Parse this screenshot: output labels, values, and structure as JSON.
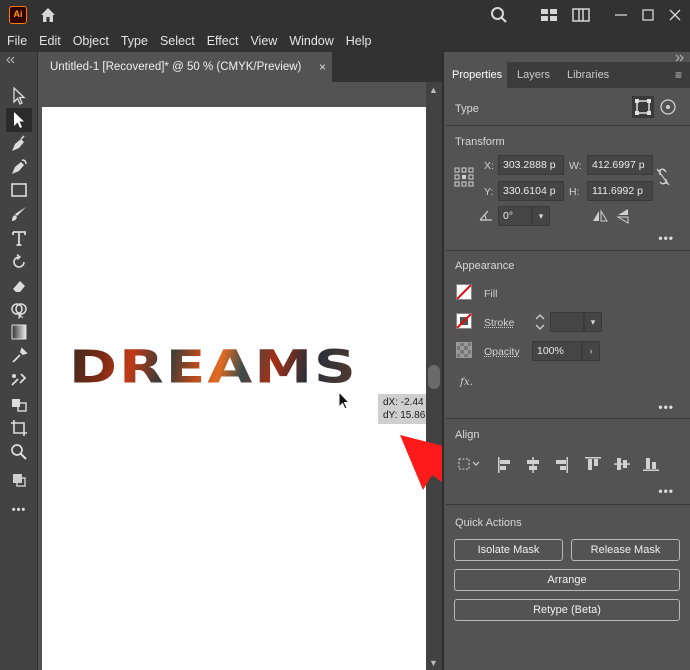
{
  "app": {
    "logo_text": "Ai",
    "colors": {
      "accent": "#ff7c00",
      "titlebar": "#323232",
      "panel": "#535353",
      "artboard": "#ffffff",
      "annotation_arrow": "#ff1a1a"
    }
  },
  "menubar": {
    "items": [
      "File",
      "Edit",
      "Object",
      "Type",
      "Select",
      "Effect",
      "View",
      "Window",
      "Help"
    ]
  },
  "document": {
    "tab_title": "Untitled-1 [Recovered]* @ 50 % (CMYK/Preview)",
    "close_glyph": "×"
  },
  "artwork": {
    "text": "DREAMS",
    "tooltip_dx": "dX: -2.44",
    "tooltip_dy": "dY: 15.86"
  },
  "panel": {
    "tabs": [
      "Properties",
      "Layers",
      "Libraries"
    ],
    "type_section": {
      "title": "Type"
    },
    "transform": {
      "title": "Transform",
      "x_label": "X:",
      "x_value": "303.2888 p",
      "y_label": "Y:",
      "y_value": "330.6104 p",
      "w_label": "W:",
      "w_value": "412.6997 p",
      "h_label": "H:",
      "h_value": "111.6992 p",
      "angle_value": "0°"
    },
    "appearance": {
      "title": "Appearance",
      "fill_label": "Fill",
      "stroke_label": "Stroke",
      "opacity_label": "Opacity",
      "opacity_value": "100%",
      "fx_label": "fx."
    },
    "align": {
      "title": "Align"
    },
    "quick_actions": {
      "title": "Quick Actions",
      "isolate_mask": "Isolate Mask",
      "release_mask": "Release Mask",
      "arrange": "Arrange",
      "retype": "Retype (Beta)"
    },
    "more_glyph": "•••"
  }
}
